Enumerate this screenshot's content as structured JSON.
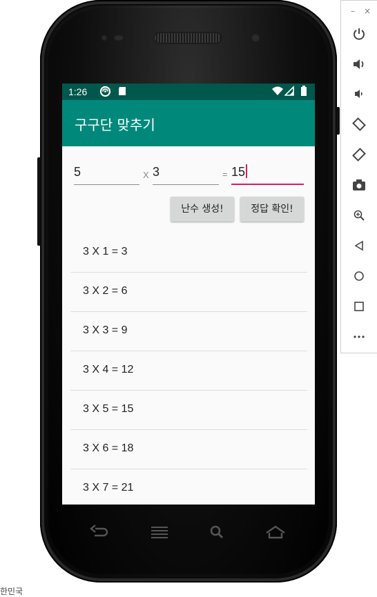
{
  "status_bar": {
    "time": "1:26",
    "icons": [
      "sync-icon",
      "sd-card-icon",
      "wifi-icon",
      "signal-icon",
      "battery-icon"
    ]
  },
  "app": {
    "title": "구구단 맞추기",
    "colors": {
      "app_bar": "#00897b",
      "status_bar": "#00574b",
      "accent": "#d81b60"
    }
  },
  "inputs": {
    "first_value": "5",
    "times_operator": "X",
    "second_value": "3",
    "equals_operator": "=",
    "answer_value": "15"
  },
  "buttons": {
    "random_label": "난수 생성!",
    "check_label": "정답 확인!"
  },
  "table": {
    "rows": [
      "3 X 1 = 3",
      "3 X 2 = 6",
      "3 X 3 = 9",
      "3 X 4 = 12",
      "3 X 5 = 15",
      "3 X 6 = 18",
      "3 X 7 = 21"
    ]
  },
  "device_nav": [
    "back-icon",
    "menu-icon",
    "search-icon",
    "home-icon"
  ],
  "emulator_toolbar": {
    "minimize": "–",
    "close": "×",
    "tools": [
      "power-icon",
      "volume-up-icon",
      "volume-down-icon",
      "rotate-left-icon",
      "rotate-right-icon",
      "camera-icon",
      "zoom-icon",
      "back-icon",
      "home-icon",
      "overview-icon",
      "more-icon"
    ]
  },
  "footer": {
    "text": "한민국"
  }
}
